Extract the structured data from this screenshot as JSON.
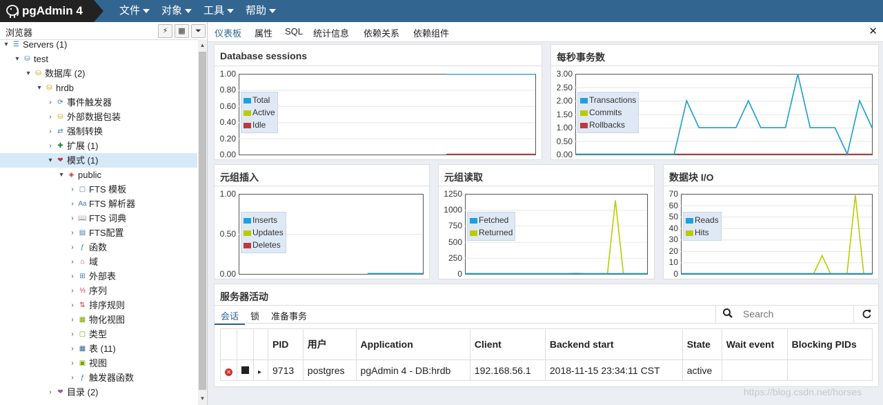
{
  "app": {
    "name": "pgAdmin 4"
  },
  "menu": {
    "items": [
      "文件",
      "对象",
      "工具",
      "帮助"
    ]
  },
  "browser": {
    "title": "浏览器",
    "tree": [
      {
        "label": "Servers (1)",
        "icon": "servers-icon",
        "arrow": "▾"
      },
      {
        "label": "test",
        "icon": "server-icon",
        "arrow": "▾"
      },
      {
        "label": "数据库 (2)",
        "icon": "databases-icon",
        "arrow": "▾"
      },
      {
        "label": "hrdb",
        "icon": "database-icon",
        "arrow": "▾"
      },
      {
        "label": "事件触发器",
        "icon": "event-trigger-icon",
        "arrow": "›"
      },
      {
        "label": "外部数据包装",
        "icon": "fdw-icon",
        "arrow": "›"
      },
      {
        "label": "强制转换",
        "icon": "cast-icon",
        "arrow": "›"
      },
      {
        "label": "扩展 (1)",
        "icon": "extension-icon",
        "arrow": "›"
      },
      {
        "label": "模式 (1)",
        "icon": "schema-icon",
        "arrow": "▾"
      },
      {
        "label": "public",
        "icon": "public-schema-icon",
        "arrow": "▾"
      },
      {
        "label": "FTS 模板",
        "icon": "fts-template-icon",
        "arrow": "›"
      },
      {
        "label": "FTS 解析器",
        "icon": "fts-parser-icon",
        "arrow": "›"
      },
      {
        "label": "FTS 词典",
        "icon": "fts-dictionary-icon",
        "arrow": "›"
      },
      {
        "label": "FTS配置",
        "icon": "fts-config-icon",
        "arrow": "›"
      },
      {
        "label": "函数",
        "icon": "function-icon",
        "arrow": "›"
      },
      {
        "label": "域",
        "icon": "domain-icon",
        "arrow": "›"
      },
      {
        "label": "外部表",
        "icon": "foreign-table-icon",
        "arrow": "›"
      },
      {
        "label": "序列",
        "icon": "sequence-icon",
        "arrow": "›"
      },
      {
        "label": "排序规则",
        "icon": "collation-icon",
        "arrow": "›"
      },
      {
        "label": "物化视图",
        "icon": "mview-icon",
        "arrow": "›"
      },
      {
        "label": "类型",
        "icon": "type-icon",
        "arrow": "›"
      },
      {
        "label": "表 (11)",
        "icon": "table-icon",
        "arrow": "›"
      },
      {
        "label": "视图",
        "icon": "view-icon",
        "arrow": "›"
      },
      {
        "label": "触发器函数",
        "icon": "trigger-function-icon",
        "arrow": "›"
      },
      {
        "label": "目录 (2)",
        "icon": "catalog-icon",
        "arrow": "›"
      }
    ]
  },
  "tabs": [
    "仪表板",
    "属性",
    "SQL",
    "统计信息",
    "依赖关系",
    "依赖组件"
  ],
  "colors": {
    "blue": "#1ba1e2",
    "green": "#b8cc00",
    "red": "#c0393b",
    "navy": "#326690"
  },
  "panels": {
    "sessions": {
      "title": "Database sessions",
      "yticks": [
        "1.00",
        "0.80",
        "0.60",
        "0.40",
        "0.20",
        "0.00"
      ],
      "legend": [
        "Total",
        "Active",
        "Idle"
      ]
    },
    "tps": {
      "title": "每秒事务数",
      "yticks": [
        "3.00",
        "2.50",
        "2.00",
        "1.50",
        "1.00",
        "0.50",
        "0.00"
      ],
      "legend": [
        "Transactions",
        "Commits",
        "Rollbacks"
      ]
    },
    "inserts": {
      "title": "元组插入",
      "yticks": [
        "1.00",
        "0.50",
        "0.00"
      ],
      "legend": [
        "Inserts",
        "Updates",
        "Deletes"
      ]
    },
    "reads": {
      "title": "元组读取",
      "yticks": [
        "1250",
        "1000",
        "750",
        "500",
        "250",
        "0"
      ],
      "legend": [
        "Fetched",
        "Returned"
      ]
    },
    "blockio": {
      "title": "数据块 I/O",
      "yticks": [
        "70",
        "60",
        "50",
        "40",
        "30",
        "20",
        "10",
        "0"
      ],
      "legend": [
        "Reads",
        "Hits"
      ]
    }
  },
  "chart_data": [
    {
      "type": "line",
      "title": "Database sessions",
      "ylim": [
        0,
        1
      ],
      "series": [
        {
          "name": "Total",
          "color": "#1ba1e2",
          "values": [
            1,
            1
          ]
        },
        {
          "name": "Active",
          "color": "#b8cc00",
          "values": [
            1,
            1
          ]
        },
        {
          "name": "Idle",
          "color": "#c0393b",
          "values": [
            0,
            0
          ]
        }
      ]
    },
    {
      "type": "line",
      "title": "每秒事务数",
      "ylim": [
        0,
        3
      ],
      "series": [
        {
          "name": "Transactions",
          "color": "#1ba1e2",
          "values": [
            0,
            0,
            0,
            0,
            0,
            0,
            0,
            0,
            0,
            2,
            1,
            1,
            1,
            1,
            2,
            1,
            1,
            1,
            3,
            1,
            1,
            1,
            0,
            2,
            1
          ]
        },
        {
          "name": "Commits",
          "color": "#b8cc00",
          "values": [
            0,
            0,
            0,
            0,
            0,
            0,
            0,
            0,
            0,
            2,
            1,
            1,
            1,
            1,
            2,
            1,
            1,
            1,
            3,
            1,
            1,
            1,
            0,
            2,
            1
          ]
        },
        {
          "name": "Rollbacks",
          "color": "#c0393b",
          "values": [
            0,
            0,
            0,
            0,
            0,
            0,
            0,
            0,
            0,
            0,
            0,
            0,
            0,
            0,
            0,
            0,
            0,
            0,
            0,
            0,
            0,
            0,
            0,
            0,
            0
          ]
        }
      ]
    },
    {
      "type": "line",
      "title": "元组插入",
      "ylim": [
        0,
        1
      ],
      "series": [
        {
          "name": "Inserts",
          "color": "#1ba1e2",
          "values": [
            0,
            0
          ]
        },
        {
          "name": "Updates",
          "color": "#b8cc00",
          "values": [
            0,
            0
          ]
        },
        {
          "name": "Deletes",
          "color": "#c0393b",
          "values": [
            0,
            0
          ]
        }
      ]
    },
    {
      "type": "line",
      "title": "元组读取",
      "ylim": [
        0,
        1250
      ],
      "series": [
        {
          "name": "Fetched",
          "color": "#1ba1e2",
          "values": [
            0,
            0,
            0,
            0,
            0,
            0,
            0,
            0,
            0,
            0,
            0,
            0,
            0,
            0,
            0,
            0,
            0,
            0,
            0,
            0
          ]
        },
        {
          "name": "Returned",
          "color": "#b8cc00",
          "values": [
            0,
            0,
            0,
            0,
            0,
            0,
            0,
            0,
            0,
            0,
            0,
            0,
            0,
            0,
            10,
            0,
            0,
            0,
            0,
            1150,
            0,
            0,
            0,
            0
          ]
        }
      ]
    },
    {
      "type": "line",
      "title": "数据块 I/O",
      "ylim": [
        0,
        70
      ],
      "series": [
        {
          "name": "Reads",
          "color": "#1ba1e2",
          "values": [
            0,
            0,
            0,
            0,
            0,
            0,
            0,
            0,
            0,
            0,
            0,
            0,
            0,
            0,
            0,
            0,
            0,
            0,
            0,
            0,
            0,
            0,
            0,
            0
          ]
        },
        {
          "name": "Hits",
          "color": "#b8cc00",
          "values": [
            0,
            0,
            0,
            0,
            0,
            0,
            0,
            0,
            0,
            0,
            0,
            0,
            0,
            0,
            0,
            0,
            0,
            16,
            0,
            0,
            0,
            69,
            0,
            0
          ]
        }
      ]
    }
  ],
  "activity": {
    "title": "服务器活动",
    "tabs": [
      "会话",
      "锁",
      "准备事务"
    ],
    "search_placeholder": "Search",
    "columns": [
      "PID",
      "用户",
      "Application",
      "Client",
      "Backend start",
      "State",
      "Wait event",
      "Blocking PIDs"
    ],
    "rows": [
      {
        "pid": "9713",
        "user": "postgres",
        "application": "pgAdmin 4 - DB:hrdb",
        "client": "192.168.56.1",
        "backend_start": "2018-11-15 23:34:11 CST",
        "state": "active",
        "wait_event": "",
        "blocking_pids": ""
      }
    ]
  },
  "watermark": "https://blog.csdn.net/horses"
}
